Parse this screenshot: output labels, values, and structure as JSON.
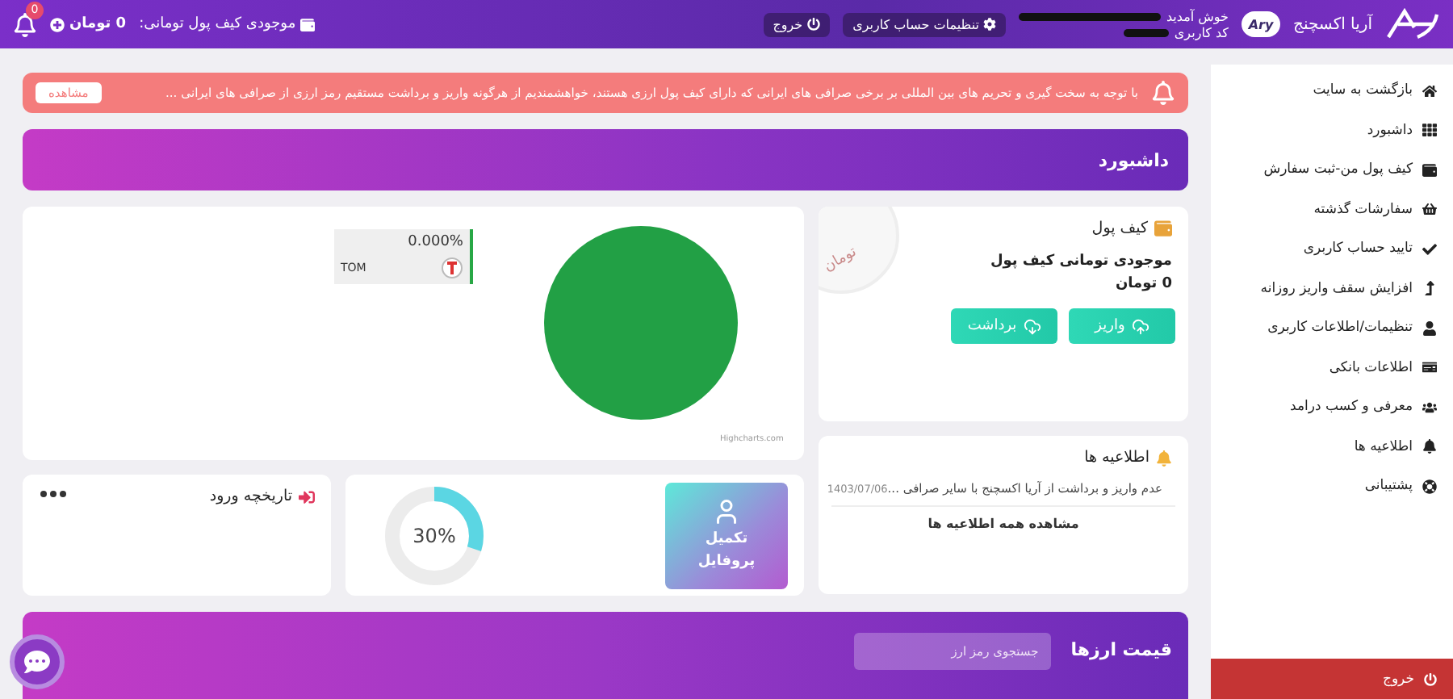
{
  "header": {
    "brand": "آریا اکسچنج",
    "avatar": "Ary",
    "welcome": "خوش آمدید",
    "user_code_label": "کد کاربری",
    "buttons": [
      {
        "kind": "settings",
        "label": "تنظیمات حساب کاربری"
      },
      {
        "kind": "logout",
        "label": "خروج"
      }
    ],
    "balance_label": "موجودی کیف پول تومانی:",
    "balance_value": "0 تومان",
    "notification_count": "0"
  },
  "sidebar": {
    "items": [
      {
        "label": "بازگشت به سایت"
      },
      {
        "label": "داشبورد"
      },
      {
        "label": "کیف پول من-ثبت سفارش"
      },
      {
        "label": "سفارشات گذشته"
      },
      {
        "label": "تایید حساب کاربری"
      },
      {
        "label": "افزایش سقف واریز روزانه"
      },
      {
        "label": "تنظیمات/اطلاعات کاربری"
      },
      {
        "label": "اطلاعات بانکی"
      },
      {
        "label": "معرفی و کسب درامد"
      },
      {
        "label": "اطلاعیه ها"
      },
      {
        "label": "پشتیبانی"
      }
    ],
    "logout": "خروج"
  },
  "alert": {
    "text": "با توجه به سخت گیری و تحریم های بین المللی بر برخی صرافی های ایرانی که دارای کیف پول ارزی هستند، خواهشمندیم از هرگونه واریز و برداشت مستقیم رمز ارزی از صرافی های ایرانی ...",
    "button": "مشاهده"
  },
  "page_title": "داشبورد",
  "wallet": {
    "title": "کیف پول",
    "coin_label": "تومان",
    "balance_label": "موجودی تومانی کیف پول",
    "balance_value": "0 تومان",
    "buttons": [
      {
        "kind": "deposit",
        "label": "واریز"
      },
      {
        "kind": "withdraw",
        "label": "برداشت"
      }
    ]
  },
  "portfolio": {
    "tooltip_value": "0.000%",
    "tooltip_symbol": "TOM",
    "credit": "Highcharts.com"
  },
  "announcements": {
    "title": "اطلاعیه ها",
    "items": [
      {
        "text": "عدم واریز و برداشت از آریا اکسچنج با سایر صرافی ...",
        "date": "1403/07/06"
      }
    ],
    "view_all": "مشاهده همه اطلاعیه ها"
  },
  "profile": {
    "label": "تکمیل پروفایل",
    "level": 0.3,
    "reading": "30%"
  },
  "login_history": {
    "title": "تاریخچه ورود"
  },
  "prices": {
    "title": "قیمت ارزها",
    "search": {
      "placeholder": "جستجوی رمز ارز"
    }
  }
}
